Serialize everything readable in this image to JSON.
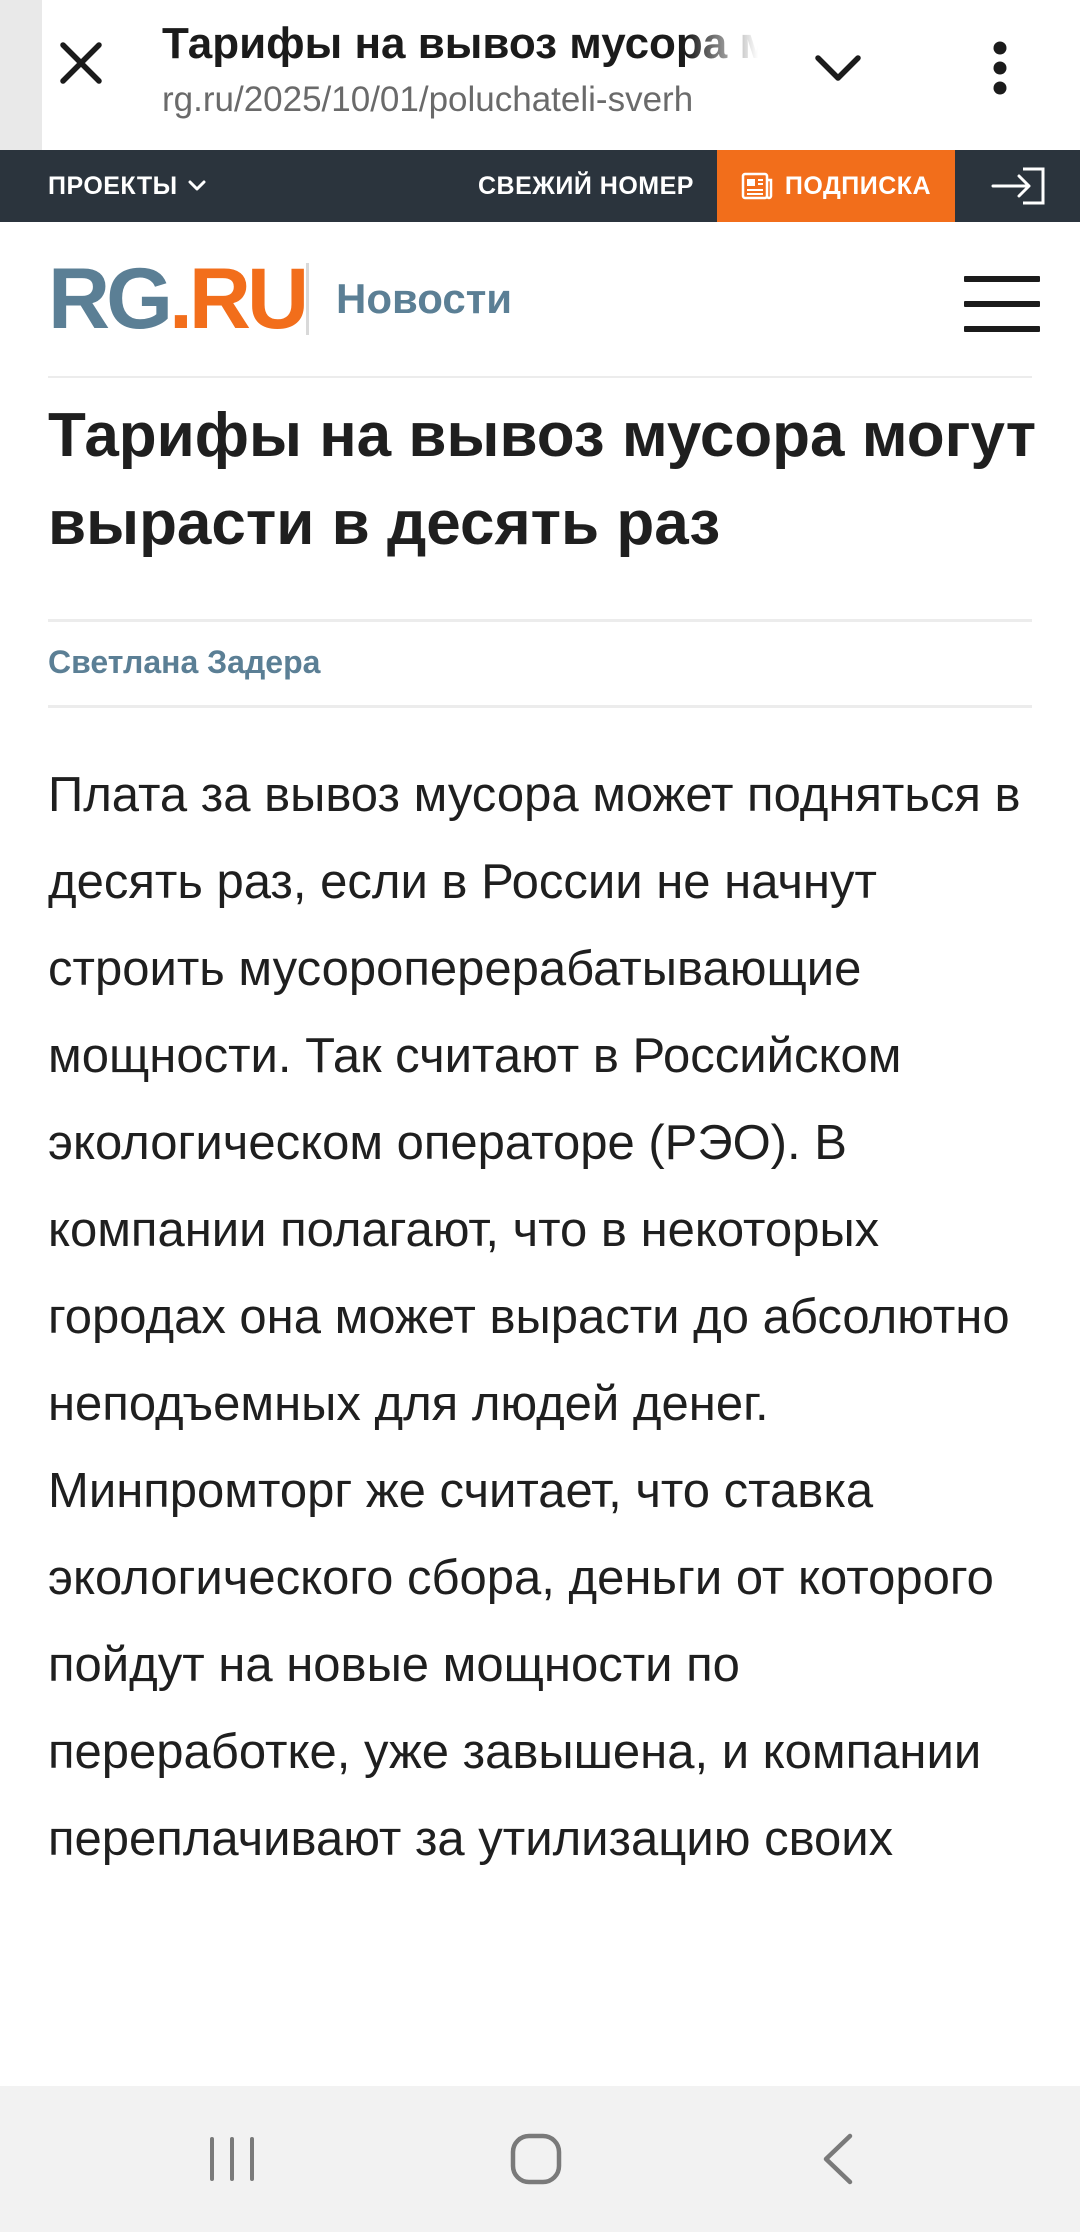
{
  "browser": {
    "tab_title": "Тарифы на вывоз мусора могут вырасти в десять раз",
    "url": "rg.ru/2025/10/01/poluchateli-sverh"
  },
  "site_bar": {
    "projects_label": "ПРОЕКТЫ",
    "fresh_issue_label": "СВЕЖИЙ НОМЕР",
    "subscribe_label": "ПОДПИСКА"
  },
  "header": {
    "logo_rg": "RG",
    "logo_dot": ".",
    "logo_ru": "RU",
    "section_label": "Новости"
  },
  "article": {
    "headline": "Тарифы на вывоз мусора могут вырасти в десять раз",
    "author": "Светлана Задера",
    "body": "Плата за вывоз мусора может подняться в десять раз, если в России не начнут строить мусороперерабатывающие мощности. Так считают в Российском экологическом операторе (РЭО). В компании полагают, что в некоторых городах она может вырасти до абсолютно неподъемных для людей денег. Минпромторг же считает, что ставка экологического сбора, деньги от которого пойдут на новые мощности по переработке, уже завышена, и компании переплачивают за утилизацию своих"
  },
  "icons": {
    "close": "close-icon",
    "expand": "chevron-down-icon",
    "menu": "more-vert-icon",
    "login": "login-icon",
    "subscribe": "newspaper-icon",
    "hamburger": "hamburger-menu-icon",
    "recents": "recents-icon",
    "home": "home-icon",
    "back": "back-icon"
  },
  "colors": {
    "brand_blue": "#5b7f95",
    "brand_orange": "#f26e1b",
    "site_bar_bg": "#2b343d"
  }
}
